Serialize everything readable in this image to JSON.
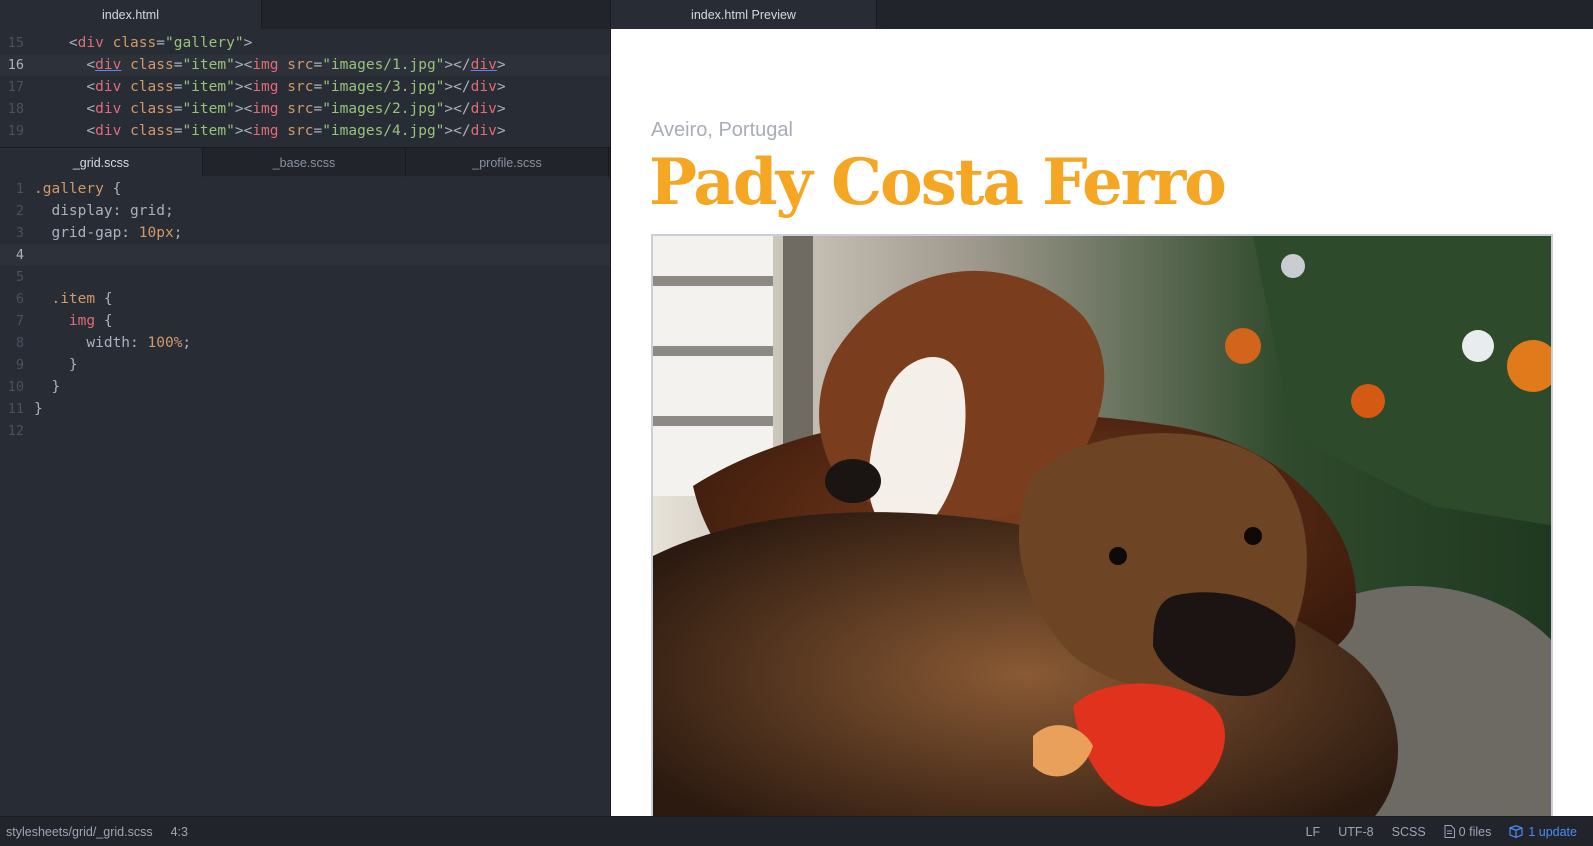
{
  "top_editor": {
    "tab": "index.html",
    "lines": [
      {
        "n": "15",
        "current": false,
        "indent": "    ",
        "tokens": [
          [
            "t-punct",
            "<"
          ],
          [
            "t-tag",
            "div"
          ],
          [
            "t-punct",
            " "
          ],
          [
            "t-attr",
            "class"
          ],
          [
            "t-punct",
            "="
          ],
          [
            "t-str",
            "\"gallery\""
          ],
          [
            "t-punct",
            ">"
          ]
        ]
      },
      {
        "n": "16",
        "current": true,
        "indent": "      ",
        "tokens": [
          [
            "t-punct",
            "<"
          ],
          [
            "t-tag t-ul",
            "div"
          ],
          [
            "t-punct",
            " "
          ],
          [
            "t-attr",
            "class"
          ],
          [
            "t-punct",
            "="
          ],
          [
            "t-str",
            "\"item\""
          ],
          [
            "t-punct",
            "><"
          ],
          [
            "t-tag",
            "img"
          ],
          [
            "t-punct",
            " "
          ],
          [
            "t-attr",
            "src"
          ],
          [
            "t-punct",
            "="
          ],
          [
            "t-str",
            "\"images/1.jpg\""
          ],
          [
            "t-punct",
            "></"
          ],
          [
            "t-tag t-ul",
            "div"
          ],
          [
            "t-punct",
            ">"
          ]
        ]
      },
      {
        "n": "17",
        "current": false,
        "indent": "      ",
        "tokens": [
          [
            "t-punct",
            "<"
          ],
          [
            "t-tag",
            "div"
          ],
          [
            "t-punct",
            " "
          ],
          [
            "t-attr",
            "class"
          ],
          [
            "t-punct",
            "="
          ],
          [
            "t-str",
            "\"item\""
          ],
          [
            "t-punct",
            "><"
          ],
          [
            "t-tag",
            "img"
          ],
          [
            "t-punct",
            " "
          ],
          [
            "t-attr",
            "src"
          ],
          [
            "t-punct",
            "="
          ],
          [
            "t-str",
            "\"images/3.jpg\""
          ],
          [
            "t-punct",
            "></"
          ],
          [
            "t-tag",
            "div"
          ],
          [
            "t-punct",
            ">"
          ]
        ]
      },
      {
        "n": "18",
        "current": false,
        "indent": "      ",
        "tokens": [
          [
            "t-punct",
            "<"
          ],
          [
            "t-tag",
            "div"
          ],
          [
            "t-punct",
            " "
          ],
          [
            "t-attr",
            "class"
          ],
          [
            "t-punct",
            "="
          ],
          [
            "t-str",
            "\"item\""
          ],
          [
            "t-punct",
            "><"
          ],
          [
            "t-tag",
            "img"
          ],
          [
            "t-punct",
            " "
          ],
          [
            "t-attr",
            "src"
          ],
          [
            "t-punct",
            "="
          ],
          [
            "t-str",
            "\"images/2.jpg\""
          ],
          [
            "t-punct",
            "></"
          ],
          [
            "t-tag",
            "div"
          ],
          [
            "t-punct",
            ">"
          ]
        ]
      },
      {
        "n": "19",
        "current": false,
        "indent": "      ",
        "tokens": [
          [
            "t-punct",
            "<"
          ],
          [
            "t-tag",
            "div"
          ],
          [
            "t-punct",
            " "
          ],
          [
            "t-attr",
            "class"
          ],
          [
            "t-punct",
            "="
          ],
          [
            "t-str",
            "\"item\""
          ],
          [
            "t-punct",
            "><"
          ],
          [
            "t-tag",
            "img"
          ],
          [
            "t-punct",
            " "
          ],
          [
            "t-attr",
            "src"
          ],
          [
            "t-punct",
            "="
          ],
          [
            "t-str",
            "\"images/4.jpg\""
          ],
          [
            "t-punct",
            "></"
          ],
          [
            "t-tag",
            "div"
          ],
          [
            "t-punct",
            ">"
          ]
        ]
      }
    ]
  },
  "bottom_editor": {
    "tabs": [
      {
        "label": "_grid.scss",
        "active": true
      },
      {
        "label": "_base.scss",
        "active": false
      },
      {
        "label": "_profile.scss",
        "active": false
      }
    ],
    "lines": [
      {
        "n": "1",
        "current": false,
        "indent": "",
        "tokens": [
          [
            "t-sel",
            ".gallery"
          ],
          [
            "t-punct",
            " {"
          ]
        ]
      },
      {
        "n": "2",
        "current": false,
        "indent": "  ",
        "tokens": [
          [
            "t-prop",
            "display: grid;"
          ]
        ]
      },
      {
        "n": "3",
        "current": false,
        "indent": "  ",
        "tokens": [
          [
            "t-prop",
            "grid-gap: "
          ],
          [
            "t-num",
            "10px"
          ],
          [
            "t-punct",
            ";"
          ]
        ]
      },
      {
        "n": "4",
        "current": true,
        "indent": "",
        "tokens": []
      },
      {
        "n": "5",
        "current": false,
        "indent": "",
        "tokens": []
      },
      {
        "n": "6",
        "current": false,
        "indent": "  ",
        "tokens": [
          [
            "t-sel",
            ".item"
          ],
          [
            "t-punct",
            " {"
          ]
        ]
      },
      {
        "n": "7",
        "current": false,
        "indent": "    ",
        "tokens": [
          [
            "t-tag",
            "img"
          ],
          [
            "t-punct",
            " {"
          ]
        ]
      },
      {
        "n": "8",
        "current": false,
        "indent": "      ",
        "tokens": [
          [
            "t-prop",
            "width: "
          ],
          [
            "t-num",
            "100%"
          ],
          [
            "t-punct",
            ";"
          ]
        ]
      },
      {
        "n": "9",
        "current": false,
        "indent": "    ",
        "tokens": [
          [
            "t-punct",
            "}"
          ]
        ]
      },
      {
        "n": "10",
        "current": false,
        "indent": "  ",
        "tokens": [
          [
            "t-punct",
            "}"
          ]
        ]
      },
      {
        "n": "11",
        "current": false,
        "indent": "",
        "tokens": [
          [
            "t-punct",
            "}"
          ]
        ]
      },
      {
        "n": "12",
        "current": false,
        "indent": "",
        "tokens": []
      }
    ]
  },
  "preview": {
    "tab": "index.html Preview",
    "location": "Aveiro, Portugal",
    "name": "Pady Costa Ferro",
    "colors": {
      "name": "#f5a623",
      "location": "#a8adb7"
    }
  },
  "statusbar": {
    "path": "stylesheets/grid/_grid.scss",
    "cursor": "4:3",
    "line_ending": "LF",
    "encoding": "UTF-8",
    "grammar": "SCSS",
    "files": "0 files",
    "update": "1 update",
    "colors": {
      "update": "#4c8cf6"
    }
  }
}
